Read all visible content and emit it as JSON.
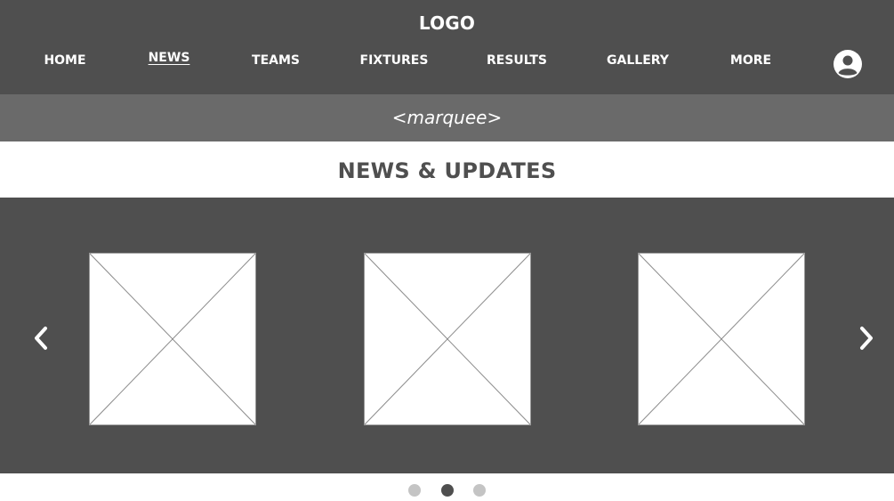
{
  "header": {
    "logo": "LOGO",
    "nav": [
      {
        "label": "HOME",
        "active": false
      },
      {
        "label": "NEWS",
        "active": true
      },
      {
        "label": "TEAMS",
        "active": false
      },
      {
        "label": "FIXTURES",
        "active": false
      },
      {
        "label": "RESULTS",
        "active": false
      },
      {
        "label": "GALLERY",
        "active": false
      },
      {
        "label": "MORE",
        "active": false
      }
    ],
    "user_icon": "user-avatar-icon"
  },
  "marquee": {
    "text": "<marquee>"
  },
  "section": {
    "title": "NEWS & UPDATES"
  },
  "carousel": {
    "prev_icon": "chevron-left-icon",
    "next_icon": "chevron-right-icon",
    "slides": [
      {
        "type": "image-placeholder"
      },
      {
        "type": "image-placeholder"
      },
      {
        "type": "image-placeholder"
      }
    ],
    "dots": [
      {
        "active": false
      },
      {
        "active": true
      },
      {
        "active": false
      }
    ]
  },
  "colors": {
    "header_bg": "#4f4f4f",
    "marquee_bg": "#6a6a6a",
    "carousel_bg": "#4f4f4f",
    "title_text": "#4f4f4f",
    "dot_inactive": "#c4c4c4",
    "dot_active": "#4f4f4f"
  }
}
